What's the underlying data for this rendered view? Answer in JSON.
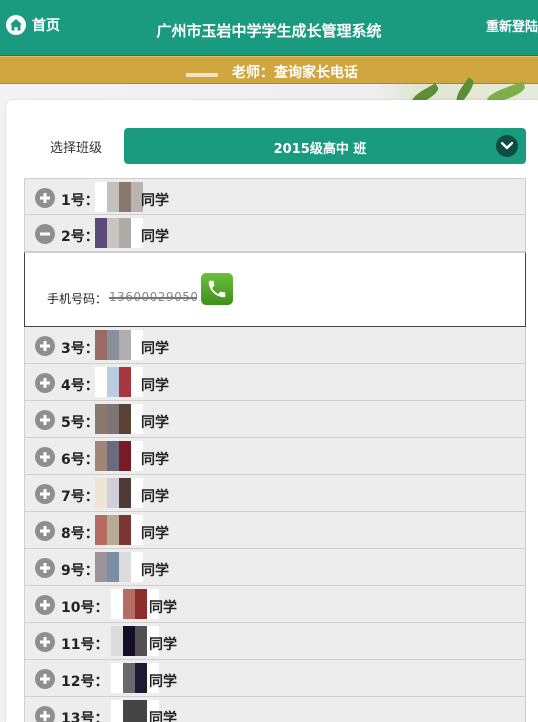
{
  "header": {
    "home_label": "首页",
    "title": "广州市玉岩中学学生成长管理系统",
    "relogin_label": "重新登陆"
  },
  "subheader": {
    "title": "老师：查询家长电话"
  },
  "class_picker": {
    "label": "选择班级",
    "value": "2015级高中   班"
  },
  "students": [
    {
      "num": "1号",
      "suffix": "同学",
      "expanded": false,
      "swatch": [
        "#ffffff",
        "#c3bfbc",
        "#8a7a6e",
        "#b9b4af"
      ]
    },
    {
      "num": "2号",
      "suffix": "同学",
      "expanded": true,
      "swatch": [
        "#5c4a78",
        "#c8c4c0",
        "#aeaaa7",
        "#ffffff"
      ]
    },
    {
      "num": "3号",
      "suffix": "同学",
      "expanded": false,
      "swatch": [
        "#9a6b65",
        "#8a8f98",
        "#b0aeb0",
        "#ffffff"
      ]
    },
    {
      "num": "4号",
      "suffix": "同学",
      "expanded": false,
      "swatch": [
        "#ffffff",
        "#b9cde0",
        "#a9363f",
        "#ffffff"
      ]
    },
    {
      "num": "5号",
      "suffix": "同学",
      "expanded": false,
      "swatch": [
        "#877870",
        "#7d7572",
        "#5a4234",
        "#ffffff"
      ]
    },
    {
      "num": "6号",
      "suffix": "同学",
      "expanded": false,
      "swatch": [
        "#a08578",
        "#6a6b7d",
        "#7a1a24",
        "#ffffff"
      ]
    },
    {
      "num": "7号",
      "suffix": "同学",
      "expanded": false,
      "swatch": [
        "#efe5d5",
        "#cfd0da",
        "#4f3a35",
        "#ffffff"
      ]
    },
    {
      "num": "8号",
      "suffix": "同学",
      "expanded": false,
      "swatch": [
        "#b76b60",
        "#b8ab93",
        "#7b3535",
        "#ffffff"
      ]
    },
    {
      "num": "9号",
      "suffix": "同学",
      "expanded": false,
      "swatch": [
        "#9a9498",
        "#7a8ea6",
        "#dcdcdc",
        "#ffffff"
      ]
    },
    {
      "num": "10号",
      "suffix": "同学",
      "expanded": false,
      "swatch": [
        "#ffffff",
        "#b36d63",
        "#8d2d2d",
        "#ffffff"
      ]
    },
    {
      "num": "11号",
      "suffix": "同学",
      "expanded": false,
      "swatch": [
        "#dcdcdc",
        "#141028",
        "#525050",
        "#ffffff"
      ]
    },
    {
      "num": "12号",
      "suffix": "同学",
      "expanded": false,
      "swatch": [
        "#ffffff",
        "#6a6a6e",
        "#1e1a34",
        "#ffffff"
      ]
    },
    {
      "num": "13号",
      "suffix": "同学",
      "expanded": false,
      "swatch": [
        "#ffffff",
        "#444444",
        "#444444",
        "#ffffff"
      ]
    }
  ],
  "detail": {
    "phone_label": "手机号码：",
    "phone_number": "13600029050"
  },
  "colors": {
    "header_bg": "#1a9b80",
    "subheader_bg": "#cfa640",
    "call_button": "#4fa52a"
  },
  "icons": {
    "home": "home-icon",
    "chevron": "chevron-down-icon",
    "expand": "plus-circle-icon",
    "collapse": "minus-circle-icon",
    "call": "phone-icon"
  }
}
